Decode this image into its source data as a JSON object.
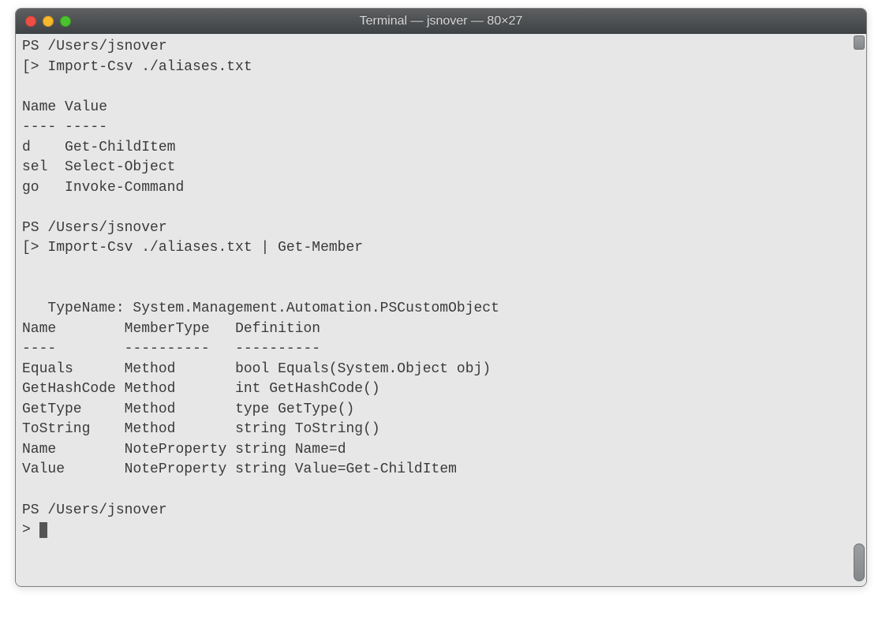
{
  "window": {
    "title": "Terminal — jsnover — 80×27"
  },
  "terminal": {
    "prompt_path": "PS /Users/jsnover",
    "prompt_marker_open": "[>",
    "prompt_marker_close": "]",
    "prompt_simple": ">",
    "command1": "Import-Csv ./aliases.txt",
    "command2": "Import-Csv ./aliases.txt | Get-Member",
    "aliases_header": {
      "col1": "Name",
      "col2": "Value",
      "sep1": "----",
      "sep2": "-----"
    },
    "aliases": [
      {
        "name": "d",
        "value": "Get-ChildItem"
      },
      {
        "name": "sel",
        "value": "Select-Object"
      },
      {
        "name": "go",
        "value": "Invoke-Command"
      }
    ],
    "typename_line": "   TypeName: System.Management.Automation.PSCustomObject",
    "members_header": {
      "col1": "Name",
      "col2": "MemberType",
      "col3": "Definition",
      "sep1": "----",
      "sep2": "----------",
      "sep3": "----------"
    },
    "members": [
      {
        "name": "Equals",
        "type": "Method",
        "def": "bool Equals(System.Object obj)"
      },
      {
        "name": "GetHashCode",
        "type": "Method",
        "def": "int GetHashCode()"
      },
      {
        "name": "GetType",
        "type": "Method",
        "def": "type GetType()"
      },
      {
        "name": "ToString",
        "type": "Method",
        "def": "string ToString()"
      },
      {
        "name": "Name",
        "type": "NoteProperty",
        "def": "string Name=d"
      },
      {
        "name": "Value",
        "type": "NoteProperty",
        "def": "string Value=Get-ChildItem"
      }
    ]
  }
}
